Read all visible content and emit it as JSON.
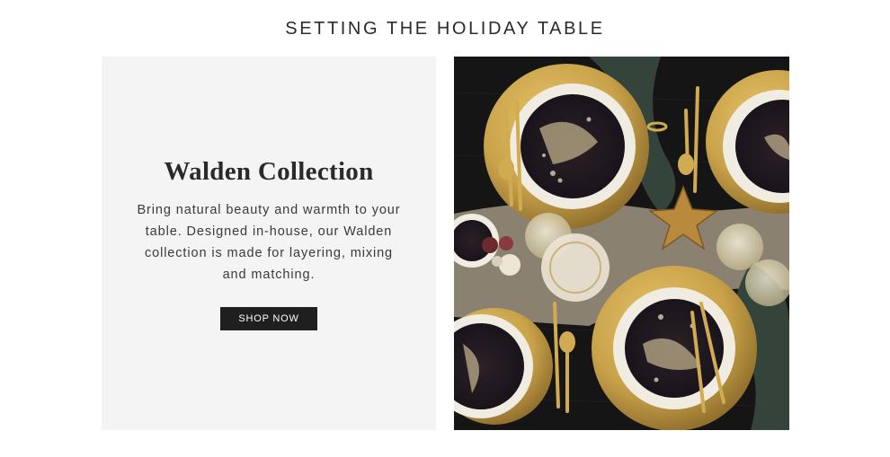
{
  "section": {
    "title": "SETTING THE HOLIDAY TABLE"
  },
  "promo": {
    "heading": "Walden Collection",
    "body": "Bring natural beauty and warmth to your table. Designed in-house, our Walden collection is made for layering, mixing and matching.",
    "button_label": "SHOP NOW"
  },
  "image": {
    "subject": "table-setting-photo",
    "colors": {
      "gold": "#c9a24a",
      "plate_dark": "#231a1e",
      "plate_rim": "#f3efe6",
      "table": "#141414",
      "linen": "#a79a82",
      "napkin": "#3b4a40"
    }
  }
}
